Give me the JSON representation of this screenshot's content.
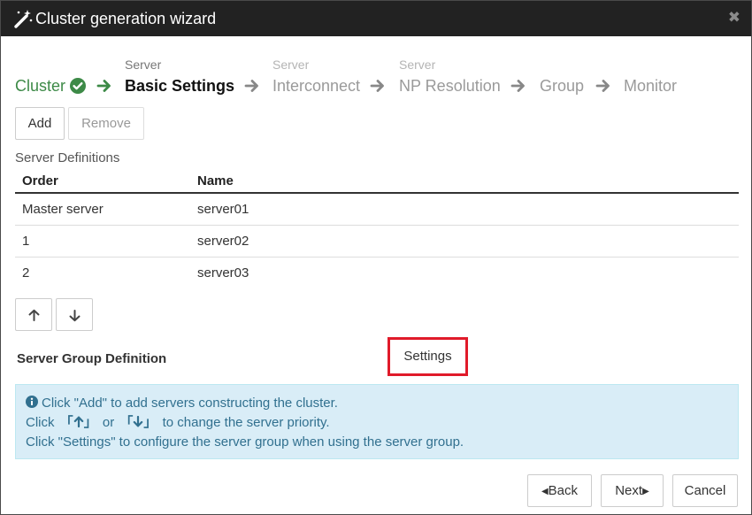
{
  "dialog": {
    "title": "Cluster generation wizard",
    "icons": {
      "title": "magic-wand-icon",
      "close": "close-icon"
    }
  },
  "steps": [
    {
      "sub": "",
      "label": "Cluster",
      "state": "done"
    },
    {
      "sub": "Server",
      "label": "Basic Settings",
      "state": "active"
    },
    {
      "sub": "Server",
      "label": "Interconnect",
      "state": "pending"
    },
    {
      "sub": "Server",
      "label": "NP Resolution",
      "state": "pending"
    },
    {
      "sub": "",
      "label": "Group",
      "state": "pending"
    },
    {
      "sub": "",
      "label": "Monitor",
      "state": "pending"
    }
  ],
  "toolbar": {
    "add_label": "Add",
    "remove_label": "Remove"
  },
  "server_definitions": {
    "label": "Server Definitions",
    "columns": [
      "Order",
      "Name"
    ],
    "rows": [
      [
        "Master server",
        "server01"
      ],
      [
        "1",
        "server02"
      ],
      [
        "2",
        "server03"
      ]
    ]
  },
  "server_group": {
    "label": "Server Group Definition",
    "settings_label": "Settings"
  },
  "info": {
    "line1": "Click \"Add\" to add servers constructing the cluster.",
    "line2_a": "Click",
    "line2_b": "or",
    "line2_c": "to change the server priority.",
    "line3": "Click \"Settings\" to configure the server group when using the server group."
  },
  "footer": {
    "back_label": "Back",
    "next_label": "Next",
    "cancel_label": "Cancel"
  },
  "colors": {
    "done_step": "#3d8a47",
    "highlight": "#e01a2a",
    "info_bg": "#d9edf7",
    "titlebar": "#222222"
  }
}
